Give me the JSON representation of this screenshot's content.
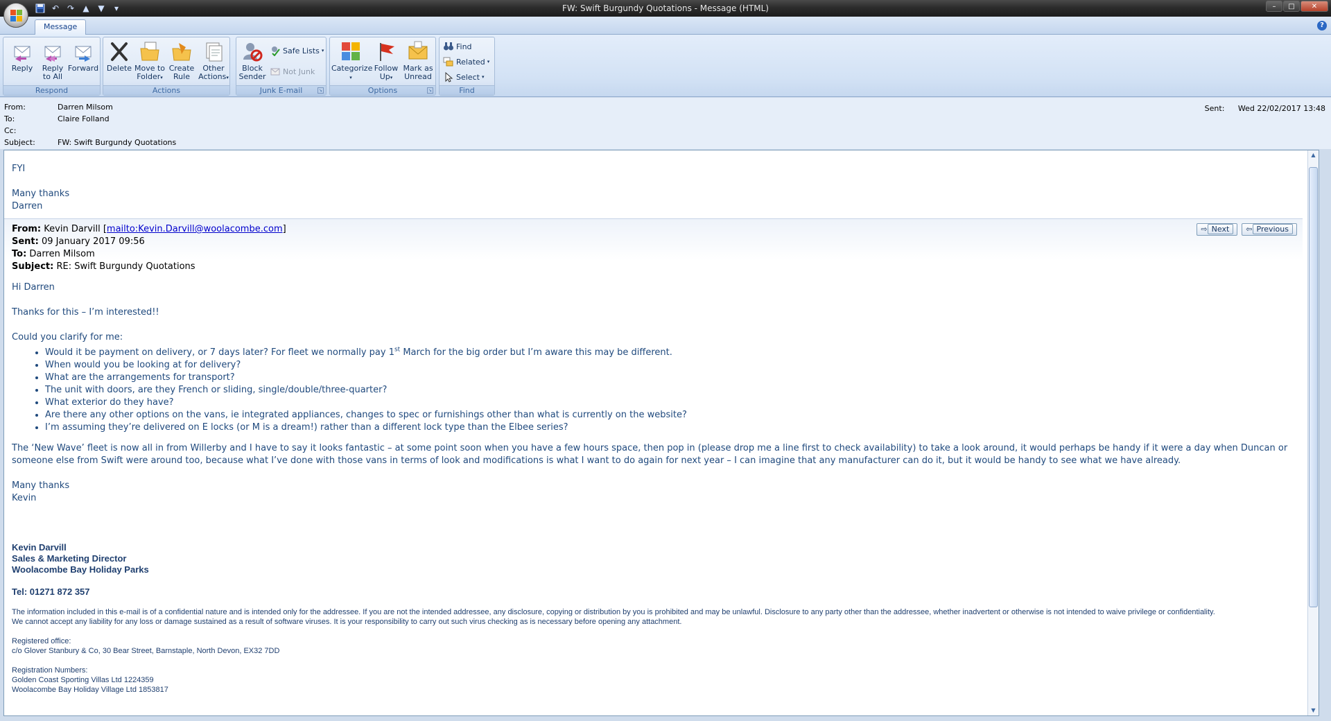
{
  "window": {
    "title": "FW: Swift Burgundy Quotations - Message (HTML)",
    "controls": {
      "minimize": "–",
      "maximize": "□",
      "close": "✕"
    }
  },
  "tabs": [
    {
      "label": "Message"
    }
  ],
  "ribbon": {
    "respond": {
      "label": "Respond",
      "reply": "Reply",
      "reply_all_1": "Reply",
      "reply_all_2": "to All",
      "forward": "Forward"
    },
    "actions": {
      "label": "Actions",
      "delete": "Delete",
      "move_1": "Move to",
      "move_2": "Folder",
      "create_1": "Create",
      "create_2": "Rule",
      "other_1": "Other",
      "other_2": "Actions"
    },
    "junk": {
      "label": "Junk E-mail",
      "block_1": "Block",
      "block_2": "Sender",
      "safe_lists": "Safe Lists",
      "not_junk": "Not Junk"
    },
    "options": {
      "label": "Options",
      "categorize": "Categorize",
      "follow_1": "Follow",
      "follow_2": "Up",
      "mark_1": "Mark as",
      "mark_2": "Unread"
    },
    "find": {
      "label": "Find",
      "find": "Find",
      "related": "Related",
      "select": "Select"
    }
  },
  "header": {
    "from_label": "From:",
    "from": "Darren Milsom",
    "to_label": "To:",
    "to": "Claire Folland",
    "cc_label": "Cc:",
    "cc": "",
    "subject_label": "Subject:",
    "subject": "FW: Swift Burgundy Quotations",
    "sent_label": "Sent:",
    "sent": "Wed 22/02/2017 13:48"
  },
  "body": {
    "intro": [
      "FYI",
      "Many thanks",
      "Darren"
    ],
    "forwarded": {
      "from_label": "From:",
      "from_name": "Kevin Darvill",
      "from_link": "mailto:Kevin.Darvill@woolacombe.com",
      "sent_label": "Sent:",
      "sent": "09 January 2017 09:56",
      "to_label": "To:",
      "to": "Darren Milsom",
      "subject_label": "Subject:",
      "subject": "RE: Swift Burgundy Quotations",
      "next": "Next",
      "previous": "Previous"
    },
    "greeting": "Hi Darren",
    "thanks_line": "Thanks for this – I’m interested!!",
    "clarify": "Could you clarify for me:",
    "bullet_1_a": "Would it be payment on delivery, or 7 days later? For fleet we normally pay 1",
    "bullet_1_sup": "st",
    "bullet_1_b": " March for the big order but I’m aware this may be different.",
    "bullets": [
      "When would you be looking at for delivery?",
      "What are the arrangements for transport?",
      "The unit with doors, are they French or sliding, single/double/three-quarter?",
      "What exterior do they have?",
      "Are there any other options on the vans, ie integrated appliances, changes to spec or furnishings other than what is currently on the website?",
      "I’m assuming they’re delivered on E locks (or M is a dream!) rather than a different lock type than the Elbee series?"
    ],
    "paragraph": "The ‘New Wave’ fleet is now all in from Willerby and I have to say it looks fantastic – at some point soon when you have a few hours space, then pop in (please drop me a line first to check availability) to take a look around, it would perhaps be handy if it were a day when Duncan or someone else from Swift were around too, because what I’ve done with those vans in terms of look and modifications is what I want to do again for next year – I can imagine that any manufacturer can do it, but it would be handy to see what we have already.",
    "closing": [
      "Many thanks",
      "Kevin"
    ],
    "signature": [
      "Kevin Darvill",
      "Sales & Marketing Director",
      "Woolacombe Bay Holiday Parks"
    ],
    "tel": "Tel: 01271 872 357",
    "disclaimer_1": "The information included in this e-mail is of a confidential nature and is intended only for the addressee. If you are not the intended addressee, any disclosure, copying or distribution by you is prohibited and may be unlawful. Disclosure to any party other than the addressee, whether inadvertent or otherwise is not intended to waive privilege or confidentiality.",
    "disclaimer_2": "We cannot accept any liability for any loss or damage sustained as a result of software viruses. It is your responsibility to carry out such virus checking as is necessary before opening any attachment.",
    "reg_office_label": "Registered office:",
    "reg_office": "c/o Glover Stanbury & Co, 30 Bear Street, Barnstaple, North Devon, EX32 7DD",
    "reg_numbers_label": "Registration Numbers:",
    "reg_numbers": [
      "Golden Coast Sporting Villas Ltd 1224359",
      "Woolacombe Bay Holiday Village Ltd 1853817"
    ]
  },
  "colors": {
    "body_text": "#1f497d",
    "ribbon_bg": "#d3e2f5",
    "header_bg": "#e6eef9"
  }
}
